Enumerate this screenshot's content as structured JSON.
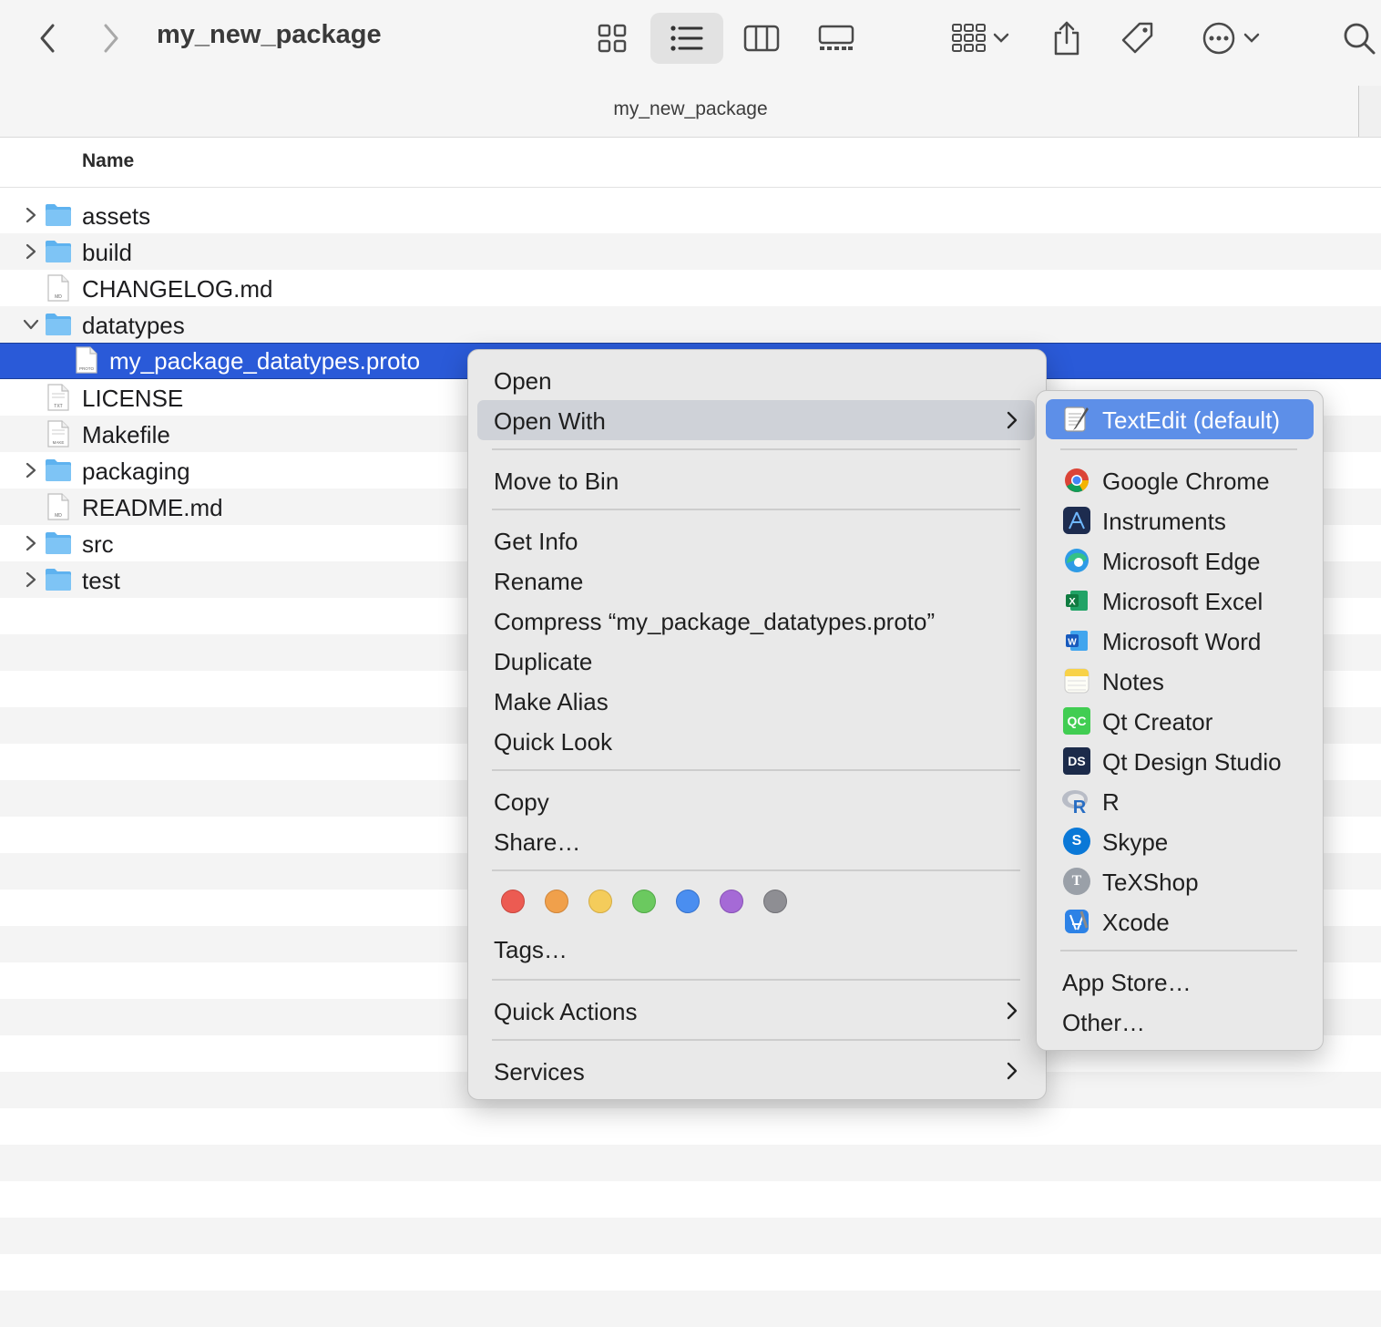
{
  "window": {
    "title": "my_new_package",
    "path_title": "my_new_package"
  },
  "toolbar": {
    "icons": [
      "back-icon",
      "forward-icon",
      "icon-view-icon",
      "list-view-icon",
      "column-view-icon",
      "gallery-view-icon",
      "group-icon",
      "share-icon",
      "tag-icon",
      "more-icon",
      "search-icon"
    ],
    "active_view": "list"
  },
  "list": {
    "column_name": "Name",
    "rows": [
      {
        "name": "assets",
        "kind": "folder",
        "disclosure": "collapsed",
        "indent": 0
      },
      {
        "name": "build",
        "kind": "folder",
        "disclosure": "collapsed",
        "indent": 0
      },
      {
        "name": "CHANGELOG.md",
        "kind": "file",
        "badge": "MD",
        "indent": 0
      },
      {
        "name": "datatypes",
        "kind": "folder",
        "disclosure": "expanded",
        "indent": 0
      },
      {
        "name": "my_package_datatypes.proto",
        "kind": "file",
        "badge": "PROTO",
        "indent": 1,
        "selected": true
      },
      {
        "name": "LICENSE",
        "kind": "file",
        "badge": "TXT",
        "indent": 0
      },
      {
        "name": "Makefile",
        "kind": "file",
        "badge": "MAKE",
        "indent": 0
      },
      {
        "name": "packaging",
        "kind": "folder",
        "disclosure": "collapsed",
        "indent": 0
      },
      {
        "name": "README.md",
        "kind": "file",
        "badge": "MD",
        "indent": 0
      },
      {
        "name": "src",
        "kind": "folder",
        "disclosure": "collapsed",
        "indent": 0
      },
      {
        "name": "test",
        "kind": "folder",
        "disclosure": "collapsed",
        "indent": 0
      }
    ]
  },
  "context_menu": {
    "items": [
      {
        "label": "Open"
      },
      {
        "label": "Open With",
        "submenu": true,
        "highlighted": true
      },
      {
        "label": "Move to Bin"
      },
      {
        "label": "Get Info"
      },
      {
        "label": "Rename"
      },
      {
        "label": "Compress “my_package_datatypes.proto”"
      },
      {
        "label": "Duplicate"
      },
      {
        "label": "Make Alias"
      },
      {
        "label": "Quick Look"
      },
      {
        "label": "Copy"
      },
      {
        "label": "Share…"
      },
      {
        "label": "Tags…"
      },
      {
        "label": "Quick Actions",
        "submenu": true
      },
      {
        "label": "Services",
        "submenu": true
      }
    ],
    "tag_colors": [
      "#ec5b52",
      "#f0a04b",
      "#f4cc5b",
      "#6bc95f",
      "#4a8ef0",
      "#a56ad6",
      "#8e8e93"
    ]
  },
  "open_with": {
    "default_app": "TextEdit (default)",
    "apps": [
      {
        "label": "Google Chrome",
        "icon": "chrome-icon"
      },
      {
        "label": "Instruments",
        "icon": "instruments-icon"
      },
      {
        "label": "Microsoft Edge",
        "icon": "edge-icon"
      },
      {
        "label": "Microsoft Excel",
        "icon": "excel-icon"
      },
      {
        "label": "Microsoft Word",
        "icon": "word-icon"
      },
      {
        "label": "Notes",
        "icon": "notes-icon"
      },
      {
        "label": "Qt Creator",
        "icon": "qt-creator-icon"
      },
      {
        "label": "Qt Design Studio",
        "icon": "qt-design-studio-icon"
      },
      {
        "label": "R",
        "icon": "r-icon"
      },
      {
        "label": "Skype",
        "icon": "skype-icon"
      },
      {
        "label": "TeXShop",
        "icon": "texshop-icon"
      },
      {
        "label": "Xcode",
        "icon": "xcode-icon"
      }
    ],
    "footer": [
      {
        "label": "App Store…"
      },
      {
        "label": "Other…"
      }
    ],
    "icon_text": {
      "qt_creator": "QC",
      "qt_design_studio": "DS",
      "r": "R",
      "skype": "S",
      "texshop": "T",
      "word": "W"
    }
  }
}
